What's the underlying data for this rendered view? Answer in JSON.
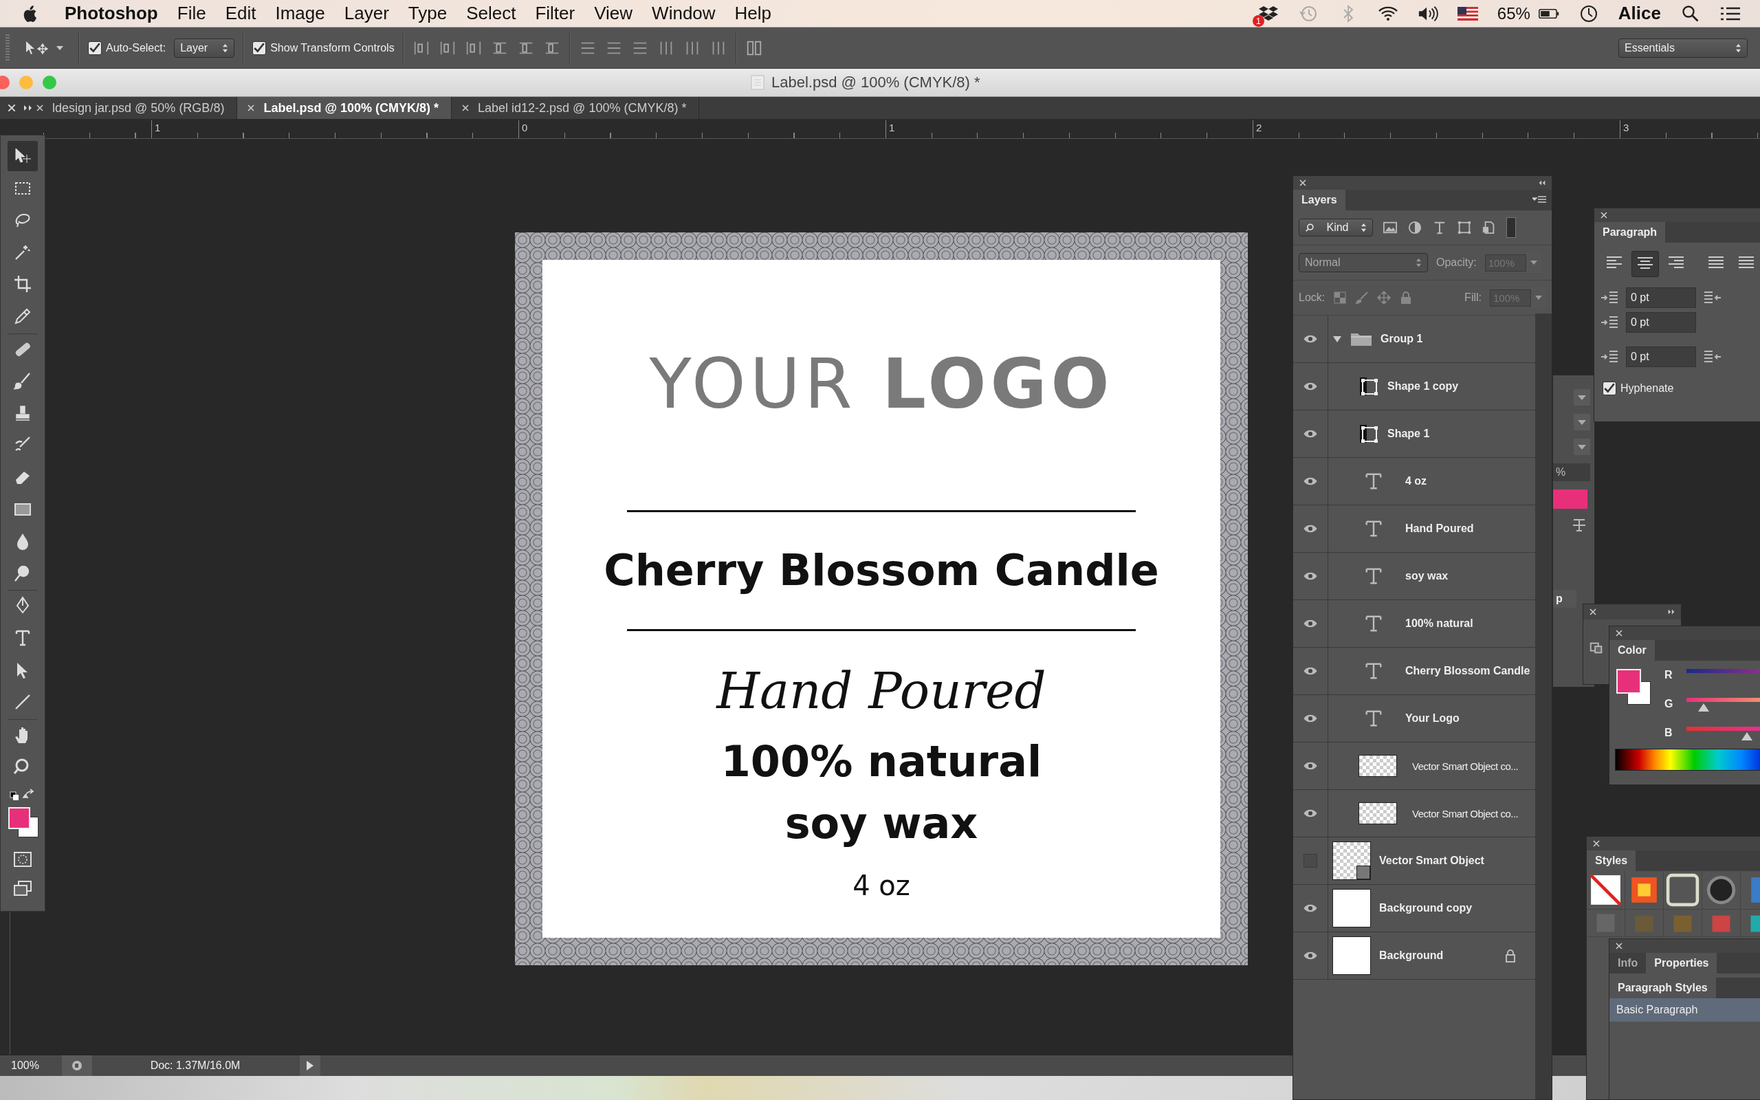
{
  "menu_bar": {
    "app": "Photoshop",
    "items": [
      "File",
      "Edit",
      "Image",
      "Layer",
      "Type",
      "Select",
      "Filter",
      "View",
      "Window",
      "Help"
    ],
    "notification_badge": "1",
    "battery": "65%",
    "user": "Alice"
  },
  "options_bar": {
    "auto_select": {
      "label": "Auto-Select:",
      "checked": true
    },
    "target": "Layer",
    "transform_controls": {
      "label": "Show Transform Controls",
      "checked": true
    },
    "workspace": "Essentials"
  },
  "window": {
    "title": "Label.psd @ 100% (CMYK/8) *"
  },
  "tabs": [
    {
      "label": "ldesign jar.psd @ 50% (RGB/8)",
      "selected": false
    },
    {
      "label": "Label.psd @ 100% (CMYK/8) *",
      "selected": true
    },
    {
      "label": "Label id12-2.psd @ 100% (CMYK/8) *",
      "selected": false
    }
  ],
  "ruler": [
    "1",
    "0",
    "1",
    "2",
    "3"
  ],
  "document": {
    "logo": "YOUR **LOGO**",
    "title": "Cherry Blossom Candle",
    "tagline": "Hand Poured",
    "lines": [
      "100% natural",
      "soy wax"
    ],
    "size": "4 oz"
  },
  "status_bar": {
    "zoom": "100%",
    "doc": "Doc: 1.37M/16.0M"
  },
  "layers_panel": {
    "tab": "Layers",
    "filter": "Kind",
    "blend_mode": "Normal",
    "opacity_label": "Opacity:",
    "opacity": "100%",
    "lock_label": "Lock:",
    "fill_label": "Fill:",
    "fill": "100%",
    "layers": [
      {
        "name": "Group 1",
        "kind": "group",
        "visible": true,
        "expanded": true,
        "locked": false,
        "children": [
          {
            "name": "Shape 1 copy",
            "kind": "shape",
            "visible": true,
            "locked": false
          },
          {
            "name": "Shape 1",
            "kind": "shape",
            "visible": true,
            "locked": false
          },
          {
            "name": "4 oz",
            "kind": "text",
            "visible": true,
            "locked": false
          },
          {
            "name": "Hand Poured",
            "kind": "text",
            "visible": true,
            "locked": false
          },
          {
            "name": "soy wax",
            "kind": "text",
            "visible": true,
            "locked": false
          },
          {
            "name": "100% natural",
            "kind": "text",
            "visible": true,
            "locked": false
          },
          {
            "name": "Cherry Blossom Candle",
            "kind": "text",
            "visible": true,
            "locked": false
          },
          {
            "name": "Your Logo",
            "kind": "text",
            "visible": true,
            "locked": false
          },
          {
            "name": "Vector Smart Object co...",
            "kind": "pixel",
            "visible": true,
            "locked": false
          },
          {
            "name": "Vector Smart Object co...",
            "kind": "pixel",
            "visible": true,
            "locked": false
          }
        ]
      },
      {
        "name": "Vector Smart Object",
        "kind": "smart",
        "visible": false,
        "locked": false
      },
      {
        "name": "Background copy",
        "kind": "fill",
        "visible": true,
        "locked": false
      },
      {
        "name": "Background",
        "kind": "fill",
        "visible": true,
        "locked": true
      }
    ]
  },
  "paragraph_panel": {
    "tab": "Paragraph",
    "alignments": [
      {
        "kind": "left",
        "selected": false
      },
      {
        "kind": "center",
        "selected": true
      },
      {
        "kind": "right",
        "selected": false
      },
      {
        "kind": "justify",
        "selected": false
      },
      {
        "kind": "justify",
        "selected": false
      }
    ],
    "fields": [
      "0 pt",
      "0 pt",
      "0 pt"
    ],
    "hyphenate": {
      "label": "Hyphenate",
      "checked": true
    }
  },
  "obscured_panel": {
    "percent_fragment": "%",
    "tab_fragment": "p"
  },
  "color_panel": {
    "tab": "Color",
    "sliders": [
      {
        "label": "R"
      },
      {
        "label": "G",
        "level": 0.2
      },
      {
        "label": "B",
        "level": 0.7
      }
    ]
  },
  "styles_panel": {
    "tab": "Styles"
  },
  "info_panel": {
    "tabs": [
      {
        "label": "Info",
        "selected": false
      },
      {
        "label": "Properties",
        "selected": true
      }
    ],
    "subtab": "Paragraph Styles",
    "styles": [
      {
        "label": "Basic Paragraph",
        "selected": true
      }
    ]
  }
}
